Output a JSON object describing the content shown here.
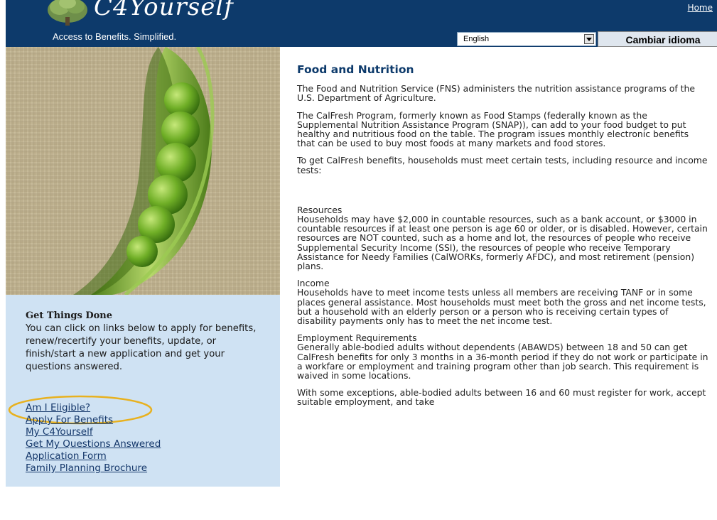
{
  "header": {
    "brand": "C4Yourself",
    "registered_mark": "®",
    "tagline": "Access to Benefits.  Simplified.",
    "home_link": "Home",
    "language": {
      "selected": "English",
      "change_button": "Cambiar idioma"
    }
  },
  "sidebar": {
    "title": "Get Things Done",
    "description": "You can click on links below to apply for benefits, renew/recertify your benefits, update, or finish/start a new application and get your questions answered.",
    "links": [
      {
        "label": "Am I Eligible?",
        "highlighted": true
      },
      {
        "label": "Apply For Benefits"
      },
      {
        "label": "My C4Yourself"
      },
      {
        "label": "Get My Questions Answered"
      },
      {
        "label": "Application Form"
      },
      {
        "label": "Family Planning Brochure"
      }
    ]
  },
  "content": {
    "title": "Food and Nutrition",
    "intro": "The Food and Nutrition Service (FNS) administers the nutrition assistance programs of the U.S. Department of Agriculture.",
    "calfresh": "The CalFresh Program, formerly known as Food Stamps (federally known as the Supplemental Nutrition Assistance Program (SNAP)), can add to your food budget to put healthy and nutritious food on the table. The program issues monthly electronic benefits that can be used to buy most foods at many markets and food stores.",
    "tests_intro": "To get CalFresh benefits, households must meet certain tests, including resource and income tests:",
    "resources_heading": "Resources",
    "resources_text": "Households may have $2,000 in countable resources, such as a bank account, or $3000 in countable resources if at least one person is age 60 or older, or is disabled. However, certain resources are NOT counted, such as a home and lot, the resources of people who receive Supplemental Security Income (SSI), the resources of people who receive Temporary Assistance for Needy Families (CalWORKs, formerly AFDC), and most retirement (pension) plans.",
    "income_heading": "Income",
    "income_text": "Households have to meet income tests unless all members are receiving TANF or in some places general assistance. Most households must meet both the gross and net income tests, but a household with an elderly person or a person who is receiving certain types of disability payments only has to meet the net income test.",
    "employment_heading": "Employment Requirements",
    "employment_text": "Generally able-bodied adults without dependents (ABAWDS) between 18 and 50 can get CalFresh benefits for only 3 months in a 36-month period if they do not work or participate in a workfare or employment and training program other than job search. This requirement is waived in some locations.",
    "exceptions_text": "With some exceptions, able-bodied adults between 16 and 60 must register for work, accept suitable employment, and take"
  },
  "icons": {
    "logo_tree": "tree-logo-icon",
    "dropdown": "chevron-down-icon"
  },
  "colors": {
    "header_bg": "#0d3a6b",
    "sidebar_bg": "#cfe2f3",
    "link": "#15386b",
    "highlight_ring": "#e8b11f"
  }
}
